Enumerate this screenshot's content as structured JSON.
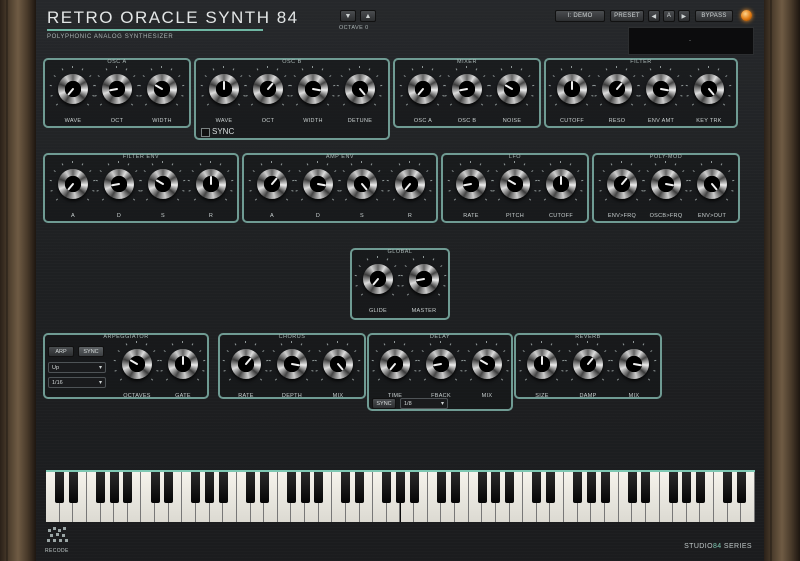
{
  "header": {
    "title": "RETRO ORACLE SYNTH 84",
    "subtitle": "POLYPHONIC ANALOG SYNTHESIZER",
    "octave_label": "OCTAVE 0",
    "octave_down": "▼",
    "octave_up": "▲",
    "demo_label": "I: DEMO",
    "preset_label": "PRESET",
    "prev_label": "◀",
    "a_label": "A",
    "next_label": "▶",
    "bypass_label": "BYPASS",
    "display_text": "-"
  },
  "osc_a": {
    "title": "OSC A",
    "knobs": [
      "WAVE",
      "OCT",
      "WIDTH"
    ]
  },
  "osc_b": {
    "title": "OSC B",
    "knobs": [
      "WAVE",
      "OCT",
      "WIDTH",
      "DETUNE"
    ],
    "sync_label": "SYNC"
  },
  "mixer": {
    "title": "MIXER",
    "knobs": [
      "OSC A",
      "OSC B",
      "NOISE"
    ]
  },
  "filter": {
    "title": "FILTER",
    "knobs": [
      "CUTOFF",
      "RESO",
      "ENV AMT",
      "KEY TRK"
    ]
  },
  "filter_env": {
    "title": "FILTER ENV",
    "knobs": [
      "A",
      "D",
      "S",
      "R"
    ]
  },
  "amp_env": {
    "title": "AMP ENV",
    "knobs": [
      "A",
      "D",
      "S",
      "R"
    ]
  },
  "lfo": {
    "title": "LFO",
    "knobs": [
      "RATE",
      "PITCH",
      "CUTOFF"
    ]
  },
  "poly_mod": {
    "title": "POLY-MOD",
    "knobs": [
      "ENV>FRQ",
      "OSCB>FRQ",
      "ENV>OUT"
    ]
  },
  "global": {
    "title": "GLOBAL",
    "knobs": [
      "GLIDE",
      "MASTER"
    ]
  },
  "arpeggiator": {
    "title": "ARPEGGIATOR",
    "arp_label": "ARP",
    "sync_label": "SYNC",
    "mode_value": "Up",
    "rate_value": "1/16",
    "knobs": [
      "OCTAVES",
      "GATE"
    ]
  },
  "chorus": {
    "title": "CHORUS",
    "knobs": [
      "RATE",
      "DEPTH",
      "MIX"
    ]
  },
  "delay": {
    "title": "DELAY",
    "knobs": [
      "TIME",
      "FBACK",
      "MIX"
    ],
    "sync_label": "SYNC",
    "time_value": "1/8"
  },
  "reverb": {
    "title": "REVERB",
    "knobs": [
      "SIZE",
      "DAMP",
      "MIX"
    ]
  },
  "footer": {
    "logo_text": "RECODE",
    "series_brand": "STUDIO",
    "series_num": "84",
    "series_suffix": "SERIES"
  },
  "colors": {
    "accent": "#7ec8b3",
    "panel_border": "#6f9b93",
    "power_led": "#e07a12"
  },
  "icons": [
    "power-icon",
    "triangle-down-icon",
    "triangle-up-icon",
    "triangle-left-icon",
    "triangle-right-icon",
    "dropdown-arrow-icon",
    "recode-logo-icon"
  ]
}
